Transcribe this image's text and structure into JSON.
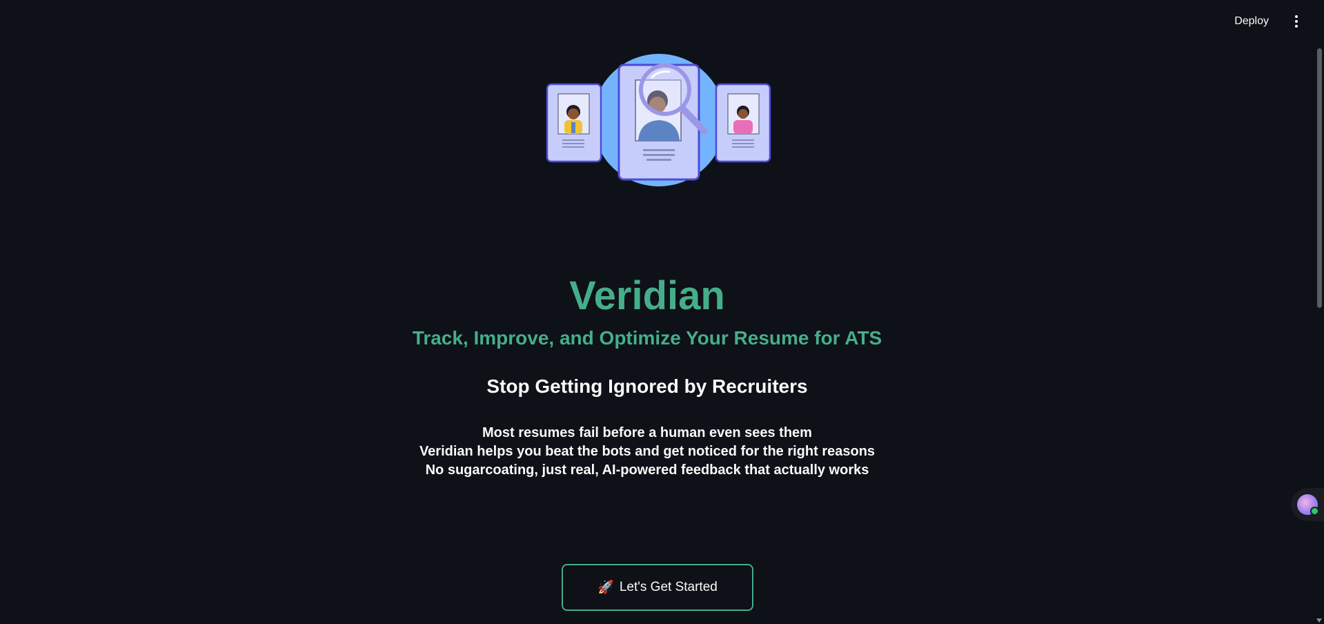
{
  "header": {
    "deploy_label": "Deploy",
    "menu_icon": "vertical-dots-icon"
  },
  "hero": {
    "illustration_icon": "resume-search-illustration",
    "title": "Veridian",
    "subtitle": "Track, Improve, and Optimize Your Resume for ATS",
    "headline": "Stop Getting Ignored by Recruiters",
    "tagline_lines": [
      "Most resumes fail before a human even sees them",
      "Veridian helps you beat the bots and get noticed for the right reasons",
      "No sugarcoating, just real, AI-powered feedback that actually works"
    ]
  },
  "cta": {
    "icon": "🚀",
    "label": "Let's Get Started"
  },
  "floating_widget": {
    "icon": "assistant-avatar-icon",
    "status": "online"
  },
  "colors": {
    "background": "#0e1117",
    "accent": "#46ad8b",
    "text": "#fafafa",
    "illustration_blue": "#74b4ff",
    "card_fill": "#c7cdfb",
    "card_border": "#4d4ad6"
  }
}
